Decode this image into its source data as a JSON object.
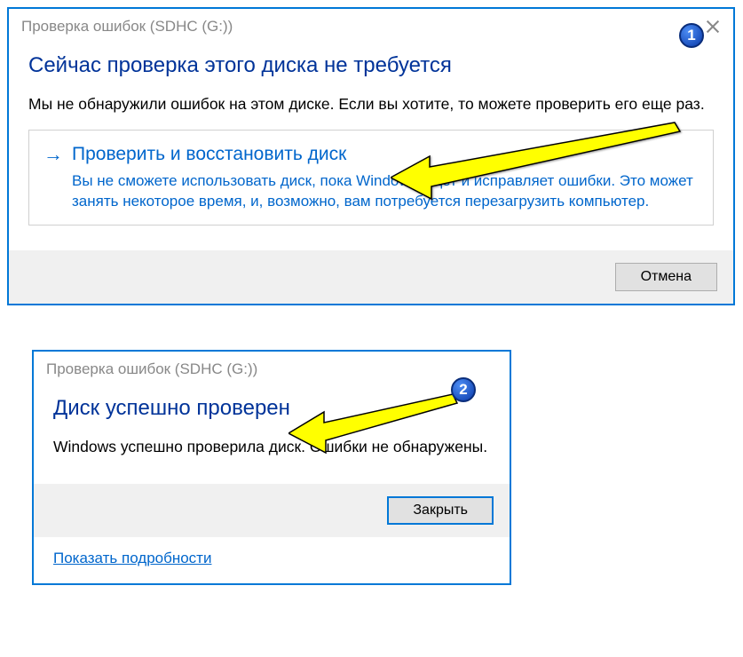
{
  "dialog1": {
    "title": "Проверка ошибок (SDHC (G:))",
    "heading": "Сейчас проверка этого диска не требуется",
    "body": "Мы не обнаружили ошибок на этом диске. Если вы хотите, то можете проверить его еще раз.",
    "action": {
      "title": "Проверить и восстановить диск",
      "desc": "Вы не сможете использовать диск, пока Windows ищет и исправляет ошибки. Это может занять некоторое время, и, возможно, вам потребуется перезагрузить компьютер."
    },
    "cancel": "Отмена",
    "badge": "1"
  },
  "dialog2": {
    "title": "Проверка ошибок (SDHC (G:))",
    "heading": "Диск успешно проверен",
    "body": "Windows успешно проверила диск. Ошибки не обнаружены.",
    "close": "Закрыть",
    "details": "Показать подробности",
    "badge": "2"
  }
}
